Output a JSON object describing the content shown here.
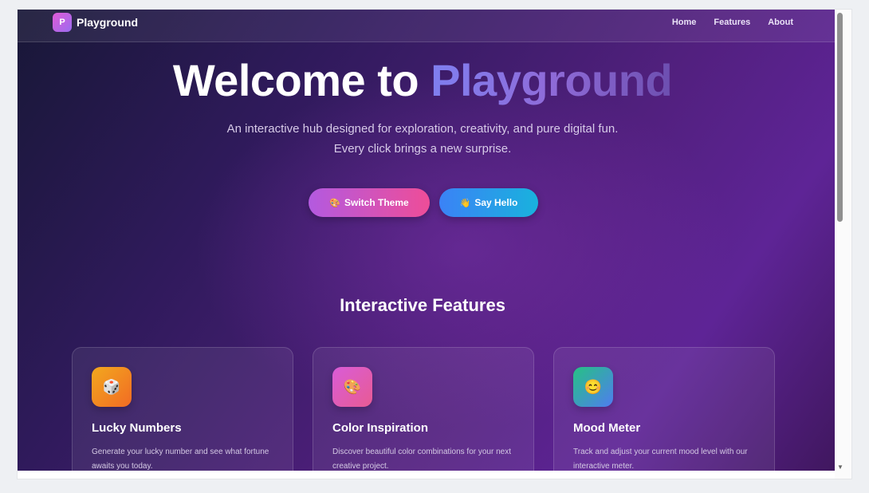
{
  "nav": {
    "logo_letter": "P",
    "brand": "Playground",
    "links": [
      "Home",
      "Features",
      "About"
    ]
  },
  "hero": {
    "title_prefix": "Welcome to ",
    "title_accent": "Playground",
    "subtitle": "An interactive hub designed for exploration, creativity, and pure digital fun. Every click brings a new surprise."
  },
  "buttons": {
    "theme": {
      "icon": "🎨",
      "label": "Switch Theme"
    },
    "hello": {
      "icon": "👋",
      "label": "Say Hello"
    }
  },
  "section": {
    "title": "Interactive Features"
  },
  "cards": [
    {
      "icon": "🎲",
      "icon_name": "dice-icon",
      "title": "Lucky Numbers",
      "desc": "Generate your lucky number and see what fortune awaits you today.",
      "colors": [
        "#f2a81e",
        "#f26b24"
      ]
    },
    {
      "icon": "🎨",
      "icon_name": "palette-icon",
      "title": "Color Inspiration",
      "desc": "Discover beautiful color combinations for your next creative project.",
      "colors": [
        "#d95cd8",
        "#e85b93"
      ]
    },
    {
      "icon": "😊",
      "icon_name": "smile-icon",
      "title": "Mood Meter",
      "desc": "Track and adjust your current mood level with our interactive meter.",
      "colors": [
        "#26c184",
        "#4f7df0"
      ]
    }
  ]
}
